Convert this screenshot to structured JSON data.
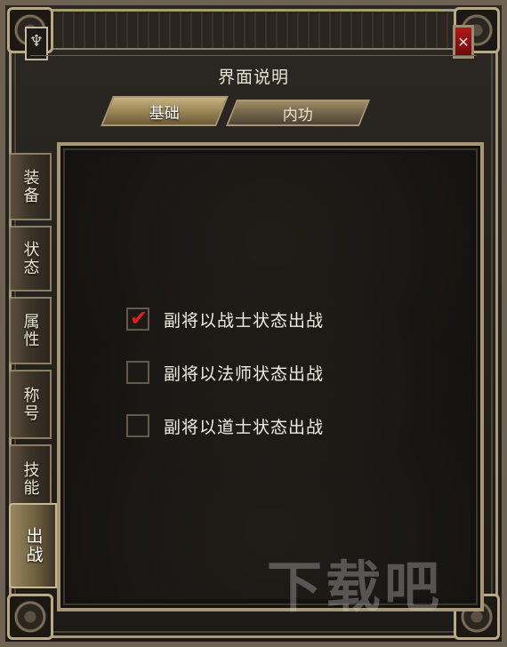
{
  "window": {
    "title": "界面说明",
    "close_label": "✕",
    "emblem": "♆"
  },
  "top_tabs": [
    {
      "label": "基础",
      "active": true
    },
    {
      "label": "内功",
      "active": false
    }
  ],
  "side_tabs": [
    {
      "label": "装备"
    },
    {
      "label": "状态"
    },
    {
      "label": "属性"
    },
    {
      "label": "称号"
    },
    {
      "label": "技能"
    },
    {
      "label": "出战",
      "active": true
    }
  ],
  "options": [
    {
      "label": "副将以战士状态出战",
      "checked": true
    },
    {
      "label": "副将以法师状态出战",
      "checked": false
    },
    {
      "label": "副将以道士状态出战",
      "checked": false
    }
  ],
  "watermark": "下载吧",
  "colors": {
    "frame": "#a89a7c",
    "check": "#e41d1d",
    "close": "#b01818"
  },
  "icons": {
    "close": "close-icon",
    "check": "checkmark-icon",
    "emblem": "trident-icon"
  }
}
